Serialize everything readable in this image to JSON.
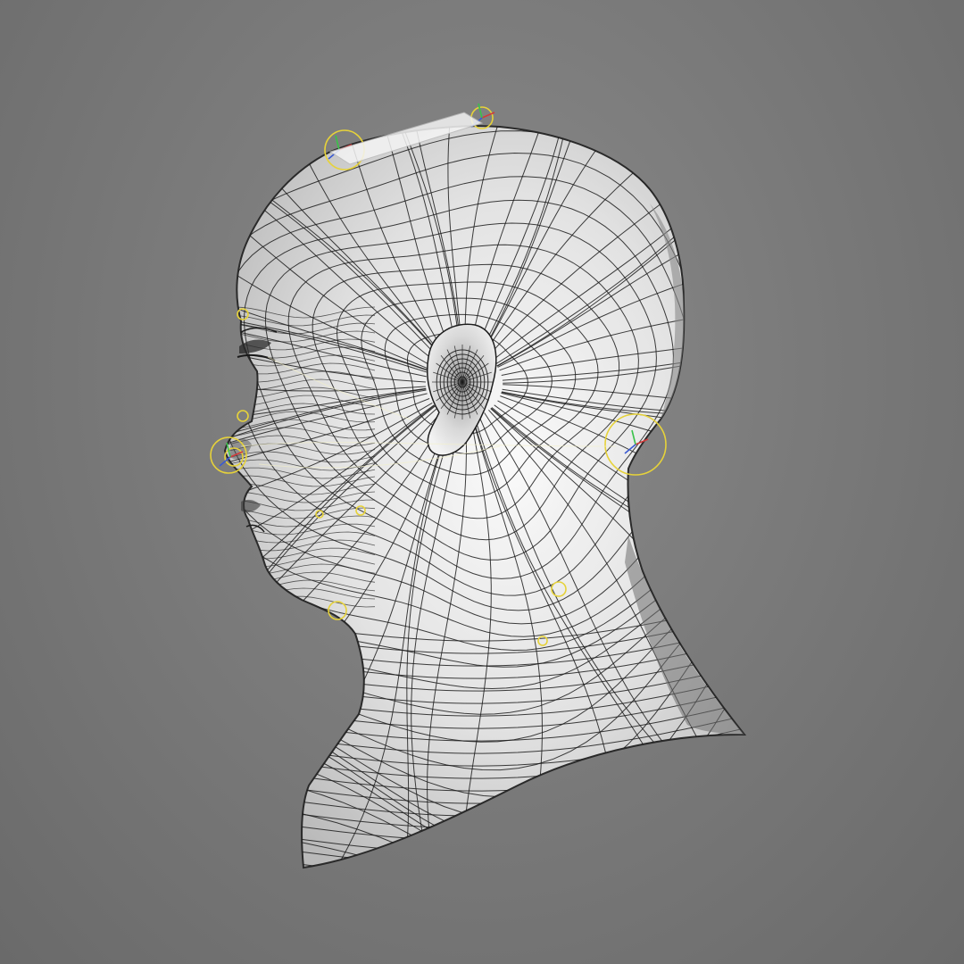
{
  "viewport": {
    "background_color": "#7b7b7b",
    "mesh_fill_color": "#e8e8e8",
    "wireframe_color": "#1c1c1c",
    "rig_control_color": "#e6d23a",
    "axis_colors": {
      "x": "#d23a3a",
      "y": "#3ac24a",
      "z": "#3a5ad2"
    }
  },
  "model": {
    "subject": "head-bust",
    "view": "left-side-profile",
    "display_mode": "shaded-wireframe",
    "rig_controls_visible": true
  }
}
